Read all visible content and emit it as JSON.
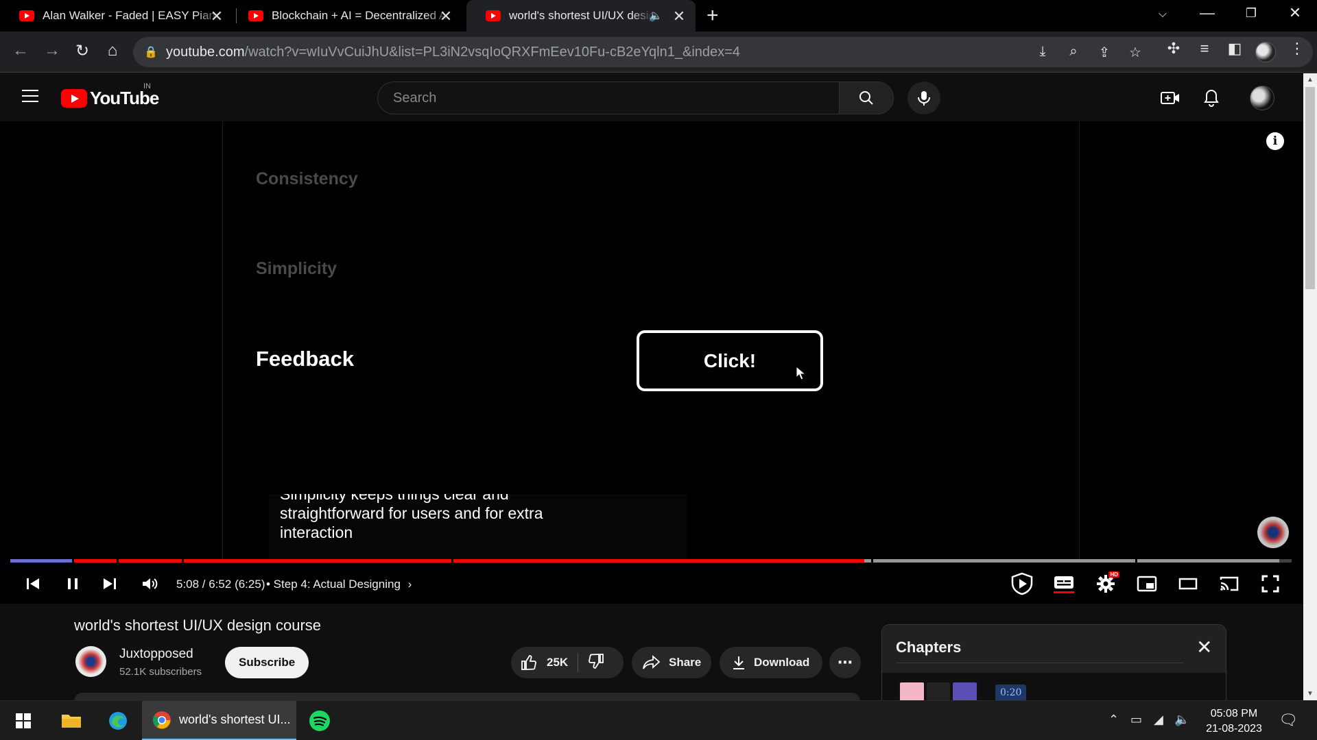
{
  "browser": {
    "tabs": [
      {
        "title": "Alan Walker - Faded | EASY Piano",
        "active": false
      },
      {
        "title": "Blockchain + AI = Decentralized A",
        "active": false
      },
      {
        "title": "world's shortest UI/UX design",
        "active": true
      }
    ],
    "url_host": "youtube.com",
    "url_path": "/watch?v=wIuVvCuiJhU&list=PL3iN2vsqIoQRXFmEev10Fu-cB2eYqln1_&index=4"
  },
  "youtube": {
    "region": "IN",
    "search_placeholder": "Search"
  },
  "video": {
    "slide_items": [
      "Consistency",
      "Simplicity",
      "Feedback"
    ],
    "demo_button": "Click!",
    "caption_lines": [
      "Simplicity keeps things clear and",
      "straightforward for users and for extra",
      "interaction"
    ],
    "info_label": "i",
    "progress_fraction": 0.6667,
    "time": "5:08 / 6:52 (6:25)",
    "chapter": "• Step 4: Actual Designing",
    "hd_badge": "HD"
  },
  "meta": {
    "title": "world's shortest UI/UX design course",
    "channel": "Juxtopposed",
    "subscribers": "52.1K subscribers",
    "subscribe_label": "Subscribe",
    "likes": "25K",
    "share_label": "Share",
    "download_label": "Download"
  },
  "chapters_panel": {
    "title": "Chapters",
    "first_time": "0:20"
  },
  "taskbar": {
    "chrome_label": "world's shortest UI...",
    "time": "05:08 PM",
    "date": "21-08-2023"
  },
  "colors": {
    "yt_red": "#ff0000",
    "bg": "#0f0f0f",
    "accent_blue": "#76b9ed"
  }
}
